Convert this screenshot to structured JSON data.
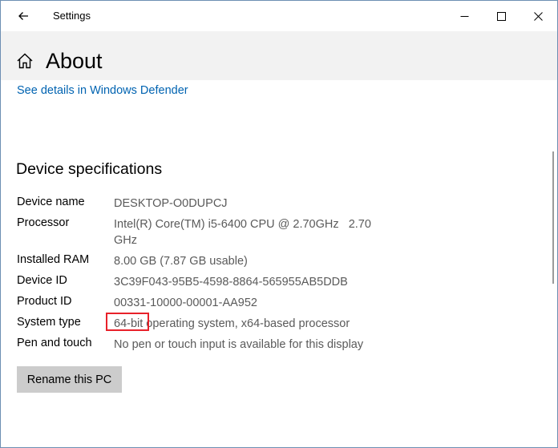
{
  "window": {
    "title": "Settings"
  },
  "header": {
    "page_title": "About"
  },
  "links": {
    "defender": "See details in Windows Defender"
  },
  "device_specs": {
    "section_title": "Device specifications",
    "rows": [
      {
        "label": "Device name",
        "value": "DESKTOP-O0DUPCJ"
      },
      {
        "label": "Processor",
        "value": "Intel(R) Core(TM) i5-6400 CPU @ 2.70GHz   2.70 GHz"
      },
      {
        "label": "Installed RAM",
        "value": "8.00 GB (7.87 GB usable)"
      },
      {
        "label": "Device ID",
        "value": "3C39F043-95B5-4598-8864-565955AB5DDB"
      },
      {
        "label": "Product ID",
        "value": "00331-10000-00001-AA952"
      },
      {
        "label": "System type",
        "value": "64-bit operating system, x64-based processor"
      },
      {
        "label": "Pen and touch",
        "value": "No pen or touch input is available for this display"
      }
    ]
  },
  "actions": {
    "rename_label": "Rename this PC"
  },
  "colors": {
    "accent_link": "#0063b1",
    "highlight_box": "#e8212a",
    "header_bg": "#f2f2f2",
    "button_bg": "#cccccc"
  },
  "icons": {
    "back": "arrow-left-icon",
    "home": "home-icon",
    "minimize": "minimize-icon",
    "maximize": "maximize-icon",
    "close": "close-icon"
  }
}
